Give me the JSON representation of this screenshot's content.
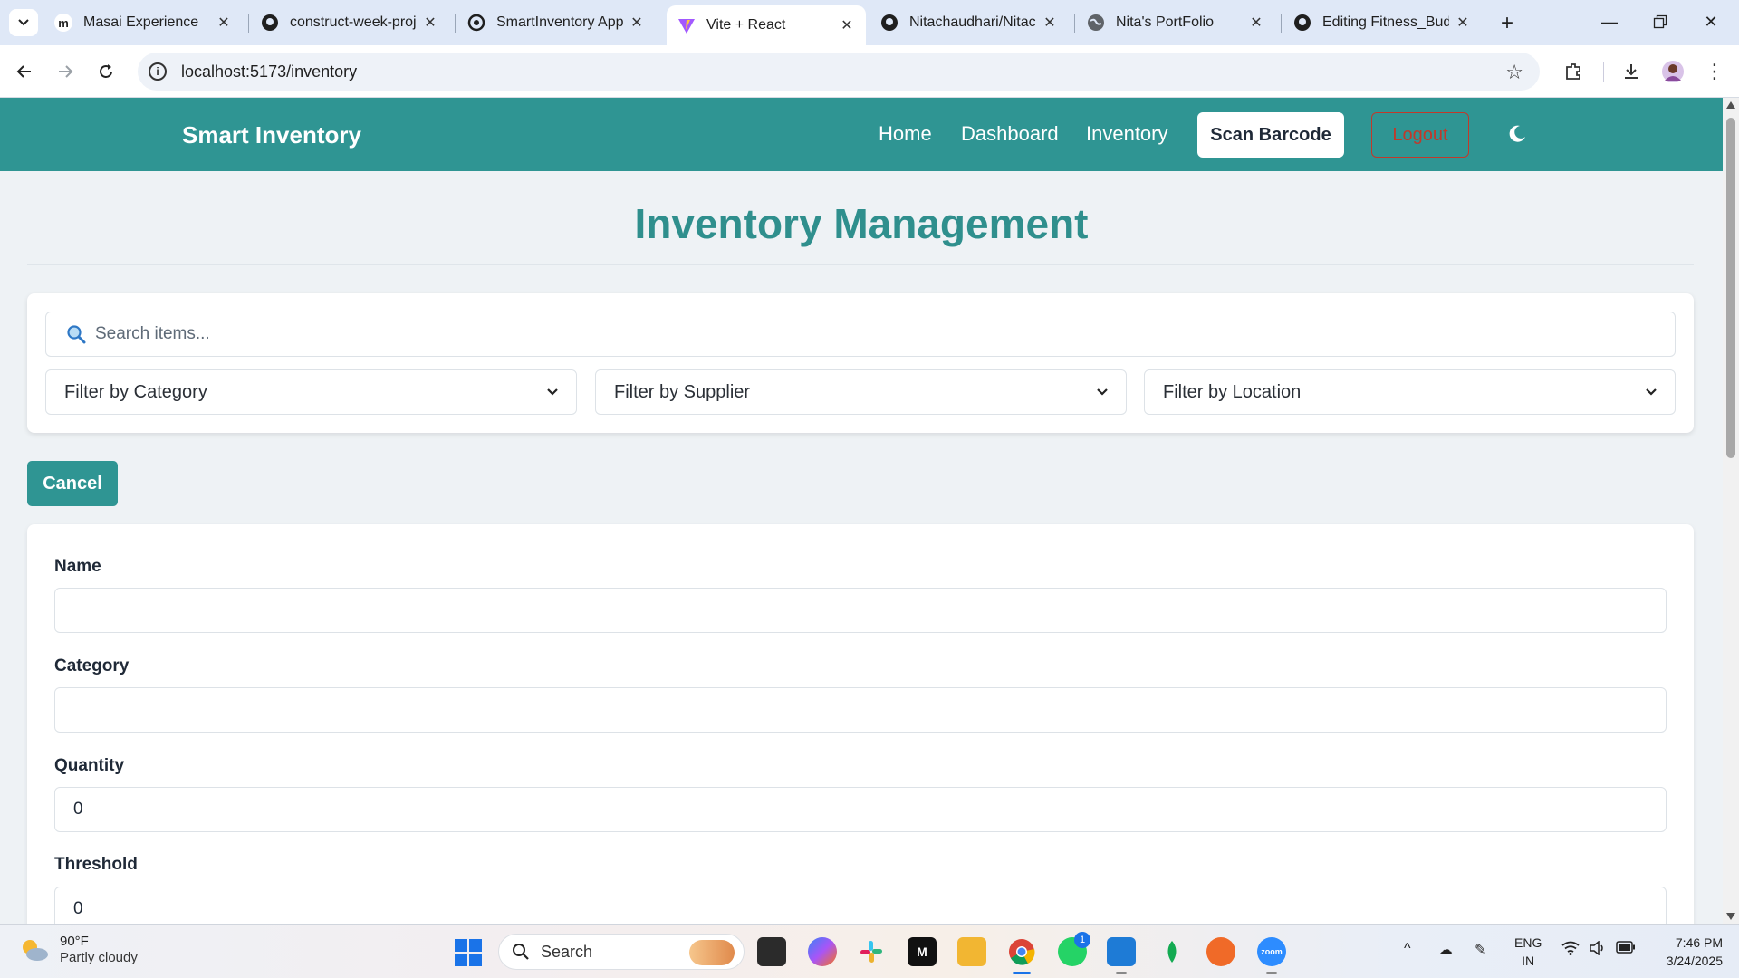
{
  "browser": {
    "tabs": [
      {
        "title": "Masai Experience",
        "icon": "masai-icon"
      },
      {
        "title": "construct-week-proje",
        "icon": "github-icon"
      },
      {
        "title": "SmartInventory App |",
        "icon": "openai-icon"
      },
      {
        "title": "Vite + React",
        "icon": "vite-icon",
        "active": true
      },
      {
        "title": "Nitachaudhari/Nitacl",
        "icon": "github-icon"
      },
      {
        "title": "Nita's PortFolio",
        "icon": "globe-icon"
      },
      {
        "title": "Editing Fitness_Budd",
        "icon": "github-icon"
      }
    ],
    "url": "localhost:5173/inventory"
  },
  "navbar": {
    "brand": "Smart Inventory",
    "links": [
      "Home",
      "Dashboard",
      "Inventory"
    ],
    "scan_label": "Scan Barcode",
    "logout_label": "Logout",
    "theme_icon": "moon-icon"
  },
  "page": {
    "title": "Inventory Management"
  },
  "filters": {
    "search_placeholder": "Search items...",
    "category": "Filter by Category",
    "supplier": "Filter by Supplier",
    "location": "Filter by Location"
  },
  "actions": {
    "cancel_label": "Cancel"
  },
  "form": {
    "name_label": "Name",
    "name_value": "",
    "category_label": "Category",
    "category_value": "",
    "quantity_label": "Quantity",
    "quantity_value": "0",
    "threshold_label": "Threshold",
    "threshold_value": "0"
  },
  "taskbar": {
    "temperature": "90°F",
    "condition": "Partly cloudy",
    "search_label": "Search",
    "whatsapp_badge": "1",
    "lang_line1": "ENG",
    "lang_line2": "IN",
    "time": "7:46 PM",
    "date": "3/24/2025"
  },
  "colors": {
    "primary": "#2f9593",
    "title": "#2f8f8d",
    "logout": "#c0392b",
    "background": "#eef2f5"
  }
}
